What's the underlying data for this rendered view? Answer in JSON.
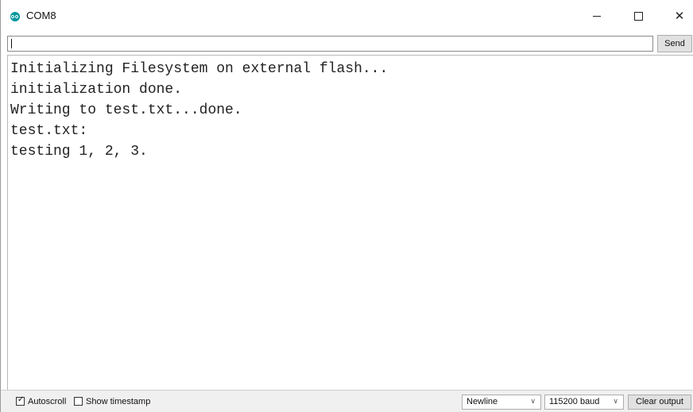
{
  "window": {
    "title": "COM8",
    "app_icon": "arduino-icon",
    "controls": {
      "minimize_icon": "minimize-icon",
      "maximize_icon": "maximize-icon",
      "close_icon": "close-icon",
      "close_glyph": "✕"
    }
  },
  "input_row": {
    "value": "",
    "send_label": "Send"
  },
  "output": {
    "lines": [
      "Initializing Filesystem on external flash...",
      "initialization done.",
      "Writing to test.txt...done.",
      "test.txt:",
      "testing 1, 2, 3."
    ]
  },
  "statusbar": {
    "autoscroll": {
      "label": "Autoscroll",
      "checked": true
    },
    "show_timestamp": {
      "label": "Show timestamp",
      "checked": false
    },
    "line_ending": {
      "selected": "Newline"
    },
    "baud_rate": {
      "selected": "115200 baud"
    },
    "clear_label": "Clear output"
  },
  "colors": {
    "accent": "#00979c"
  }
}
